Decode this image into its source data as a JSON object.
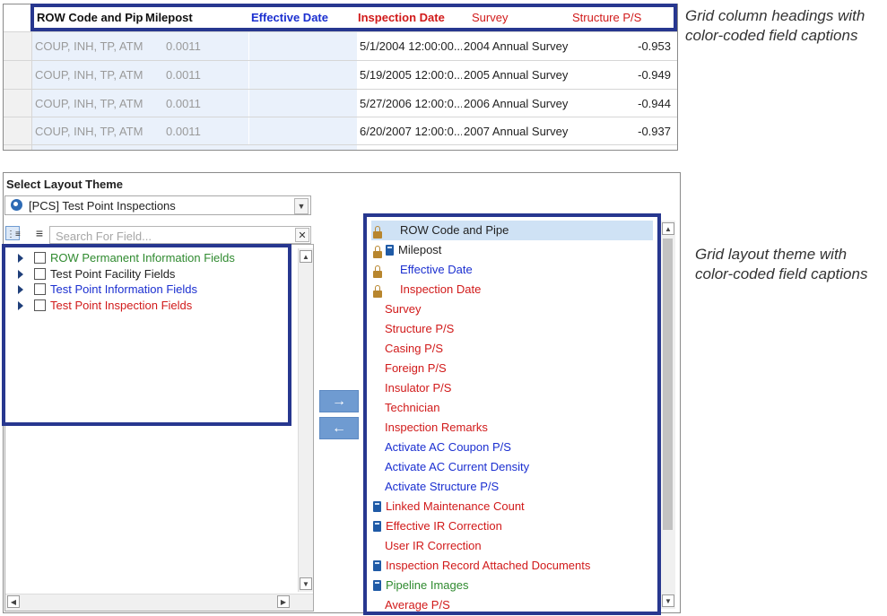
{
  "grid": {
    "headers": [
      {
        "label": "ROW Code and Pipe",
        "color": "#111111"
      },
      {
        "label": "Milepost",
        "color": "#111111"
      },
      {
        "label": "Effective Date",
        "color": "#1b2fd0"
      },
      {
        "label": "Inspection Date",
        "color": "#d11a1a"
      },
      {
        "label": "Survey",
        "color": "#d11a1a"
      },
      {
        "label": "Structure P/S",
        "color": "#d11a1a"
      }
    ],
    "rows": [
      {
        "row_code": "COUP, INH, TP, ATMO",
        "milepost": "0.0011",
        "effective_date": "",
        "inspection_date": "5/1/2004 12:00:00...",
        "survey": "2004 Annual Survey",
        "structure_ps": "-0.953"
      },
      {
        "row_code": "COUP, INH, TP, ATMO",
        "milepost": "0.0011",
        "effective_date": "",
        "inspection_date": "5/19/2005 12:00:0...",
        "survey": "2005 Annual Survey",
        "structure_ps": "-0.949"
      },
      {
        "row_code": "COUP, INH, TP, ATMO",
        "milepost": "0.0011",
        "effective_date": "",
        "inspection_date": "5/27/2006 12:00:0...",
        "survey": "2006 Annual Survey",
        "structure_ps": "-0.944"
      },
      {
        "row_code": "COUP, INH, TP, ATMO",
        "milepost": "0.0011",
        "effective_date": "",
        "inspection_date": "6/20/2007 12:00:0...",
        "survey": "2007 Annual Survey",
        "structure_ps": "-0.937"
      }
    ]
  },
  "callouts": {
    "grid_headings": "Grid column headings with color-coded field captions",
    "layout_theme": "Grid layout theme with color-coded field captions"
  },
  "layout": {
    "title": "Select Layout Theme",
    "theme_value": "[PCS] Test Point Inspections",
    "search_placeholder": "Search For Field...",
    "tree": [
      {
        "label": "ROW Permanent Information Fields",
        "color": "#2f8a2f"
      },
      {
        "label": "Test Point Facility Fields",
        "color": "#222222"
      },
      {
        "label": "Test Point Information Fields",
        "color": "#1b2fd0"
      },
      {
        "label": "Test Point Inspection Fields",
        "color": "#d11a1a"
      }
    ],
    "move_right": "→",
    "move_left": "←",
    "fields": [
      {
        "label": "ROW Code and Pipe",
        "color": "#222222",
        "icons": [
          "lock-icon"
        ]
      },
      {
        "label": "Milepost",
        "color": "#222222",
        "icons": [
          "lock-icon",
          "calculator-icon"
        ]
      },
      {
        "label": "Effective Date",
        "color": "#1b2fd0",
        "icons": [
          "lock-icon"
        ]
      },
      {
        "label": "Inspection Date",
        "color": "#d11a1a",
        "icons": [
          "lock-icon"
        ]
      },
      {
        "label": "Survey",
        "color": "#d11a1a",
        "icons": []
      },
      {
        "label": "Structure P/S",
        "color": "#d11a1a",
        "icons": []
      },
      {
        "label": "Casing P/S",
        "color": "#d11a1a",
        "icons": []
      },
      {
        "label": "Foreign P/S",
        "color": "#d11a1a",
        "icons": []
      },
      {
        "label": "Insulator P/S",
        "color": "#d11a1a",
        "icons": []
      },
      {
        "label": "Technician",
        "color": "#d11a1a",
        "icons": []
      },
      {
        "label": "Inspection Remarks",
        "color": "#d11a1a",
        "icons": []
      },
      {
        "label": "Activate AC Coupon P/S",
        "color": "#1b2fd0",
        "icons": []
      },
      {
        "label": "Activate AC Current Density",
        "color": "#1b2fd0",
        "icons": []
      },
      {
        "label": "Activate Structure P/S",
        "color": "#1b2fd0",
        "icons": []
      },
      {
        "label": "Linked Maintenance Count",
        "color": "#d11a1a",
        "icons": [
          "calculator-icon"
        ]
      },
      {
        "label": "Effective IR Correction",
        "color": "#d11a1a",
        "icons": [
          "calculator-icon"
        ]
      },
      {
        "label": "User IR Correction",
        "color": "#d11a1a",
        "icons": []
      },
      {
        "label": "Inspection Record Attached Documents",
        "color": "#d11a1a",
        "icons": [
          "calculator-icon"
        ]
      },
      {
        "label": "Pipeline Images",
        "color": "#2f8a2f",
        "icons": [
          "calculator-icon"
        ]
      },
      {
        "label": "Average P/S",
        "color": "#d11a1a",
        "icons": []
      }
    ]
  }
}
